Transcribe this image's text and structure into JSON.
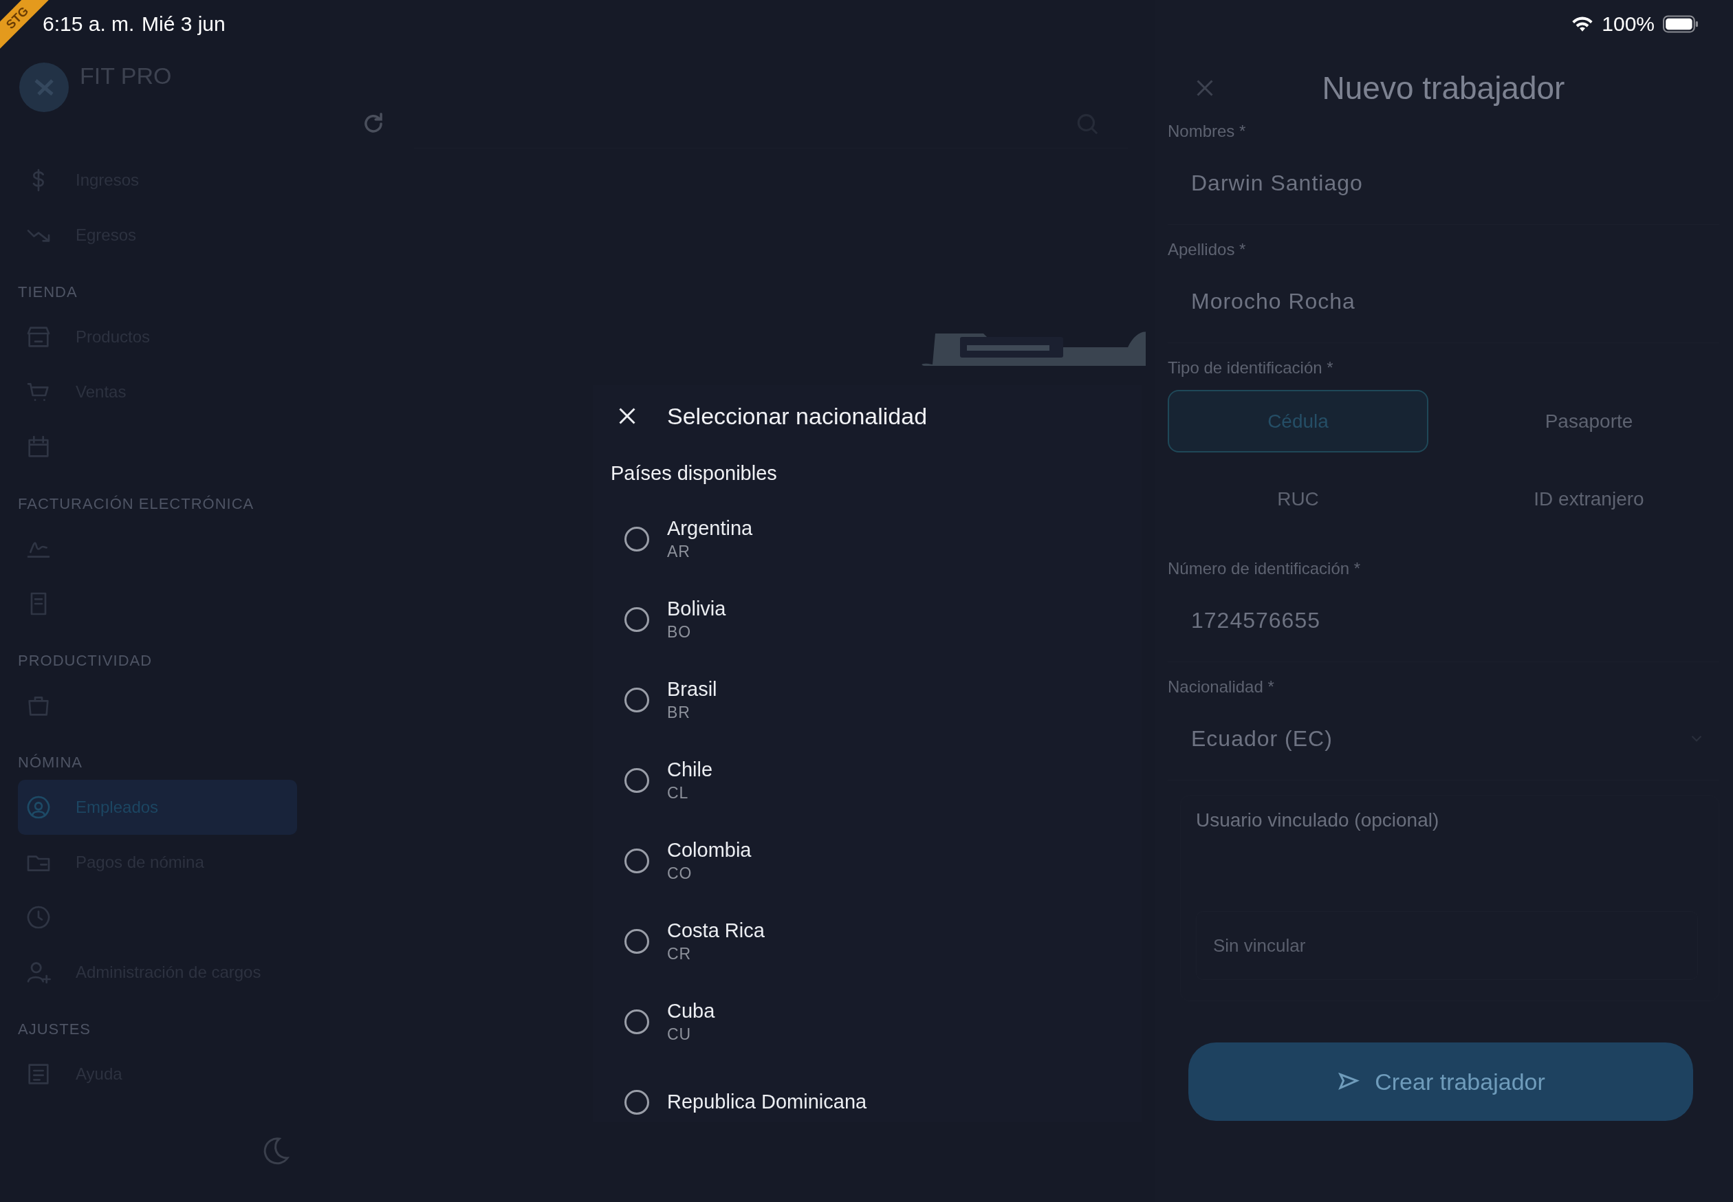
{
  "status_bar": {
    "time": "6:15 a. m.",
    "date": "Mié 3 jun",
    "battery": "100%",
    "ribbon": "STG"
  },
  "sidebar": {
    "brand": "FIT PRO",
    "items": [
      {
        "kind": "item",
        "label": "Ingresos",
        "selected": false
      },
      {
        "kind": "item",
        "label": "Egresos",
        "selected": false
      },
      {
        "kind": "section",
        "label": "TIENDA"
      },
      {
        "kind": "item",
        "label": "Productos",
        "selected": false
      },
      {
        "kind": "item",
        "label": "Ventas",
        "selected": false
      },
      {
        "kind": "item",
        "selected": false
      },
      {
        "kind": "section",
        "label": "FACTURACIÓN ELECTRÓNICA"
      },
      {
        "kind": "item",
        "selected": false
      },
      {
        "kind": "item",
        "selected": false
      },
      {
        "kind": "section",
        "label": "PRODUCTIVIDAD"
      },
      {
        "kind": "item",
        "selected": false
      },
      {
        "kind": "section",
        "label": "NÓMINA"
      },
      {
        "kind": "item",
        "label": "Empleados",
        "selected": true
      },
      {
        "kind": "item",
        "label": "Pagos de nómina",
        "selected": false
      },
      {
        "kind": "item",
        "selected": false
      },
      {
        "kind": "item",
        "label": "Administración de cargos",
        "selected": false
      },
      {
        "kind": "section",
        "label": "AJUSTES"
      },
      {
        "kind": "item",
        "label": "Ayuda",
        "selected": false
      }
    ]
  },
  "modal": {
    "title": "Seleccionar nacionalidad",
    "section": "Países disponibles",
    "countries": [
      {
        "name": "Argentina",
        "code": "AR",
        "selected": false
      },
      {
        "name": "Bolivia",
        "code": "BO",
        "selected": false
      },
      {
        "name": "Brasil",
        "code": "BR",
        "selected": false
      },
      {
        "name": "Chile",
        "code": "CL",
        "selected": false
      },
      {
        "name": "Colombia",
        "code": "CO",
        "selected": false
      },
      {
        "name": "Costa Rica",
        "code": "CR",
        "selected": false
      },
      {
        "name": "Cuba",
        "code": "CU",
        "selected": false
      },
      {
        "name": "Republica Dominicana",
        "selected": false
      }
    ]
  },
  "panel": {
    "title": "Nuevo trabajador",
    "fields_top": [
      {
        "label": "Nombres *",
        "value": "Darwin Santiago"
      },
      {
        "label": "Apellidos *",
        "value": "Morocho Rocha"
      }
    ],
    "id_type": {
      "label": "Tipo de identificación *",
      "options": [
        {
          "label": "Cédula",
          "selected": true
        },
        {
          "label": "Pasaporte",
          "selected": false
        },
        {
          "label": "RUC",
          "selected": false
        },
        {
          "label": "ID extranjero",
          "selected": false
        }
      ]
    },
    "id_number": {
      "label": "Número de identificación *",
      "value": "1724576655"
    },
    "nationality": {
      "label": "Nacionalidad *",
      "value": "Ecuador (EC)"
    },
    "linked_user": {
      "title": "Usuario vinculado (opcional)",
      "placeholder": "Sin vincular"
    },
    "submit": "Crear trabajador"
  }
}
